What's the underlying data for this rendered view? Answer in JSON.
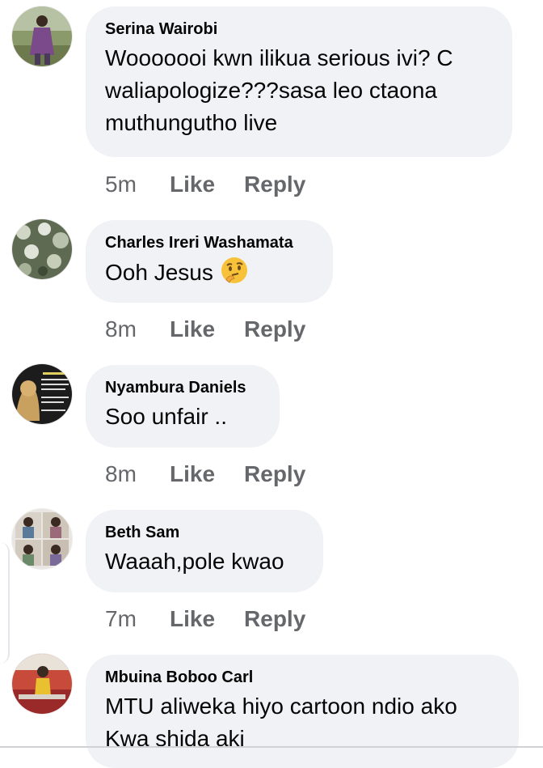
{
  "comments": [
    {
      "author": "Serina Wairobi",
      "text": "Wooooooi kwn ilikua serious ivi? C waliapologize???sasa leo ctaona muthungutho live",
      "time": "5m",
      "like_label": "Like",
      "reply_label": "Reply",
      "avatar_icon": "avatar-photo-person-standing"
    },
    {
      "author": "Charles Ireri Washamata",
      "text": "Ooh Jesus",
      "emoji_icon": "thinking-face-icon",
      "time": "8m",
      "like_label": "Like",
      "reply_label": "Reply",
      "avatar_icon": "avatar-photo-plants"
    },
    {
      "author": "Nyambura Daniels",
      "text": "Soo unfair ..",
      "time": "8m",
      "like_label": "Like",
      "reply_label": "Reply",
      "avatar_icon": "avatar-photo-lion-poster"
    },
    {
      "author": "Beth Sam",
      "text": "Waaah,pole kwao",
      "time": "7m",
      "like_label": "Like",
      "reply_label": "Reply",
      "avatar_icon": "avatar-photo-collage"
    },
    {
      "author": "Mbuina Boboo Carl",
      "text": "MTU aliweka hiyo cartoon ndio ako Kwa shida aki",
      "avatar_icon": "avatar-photo-person-red-room"
    }
  ],
  "colors": {
    "bubble": "#f0f2f5",
    "text": "#050505",
    "secondary": "#65676b"
  }
}
